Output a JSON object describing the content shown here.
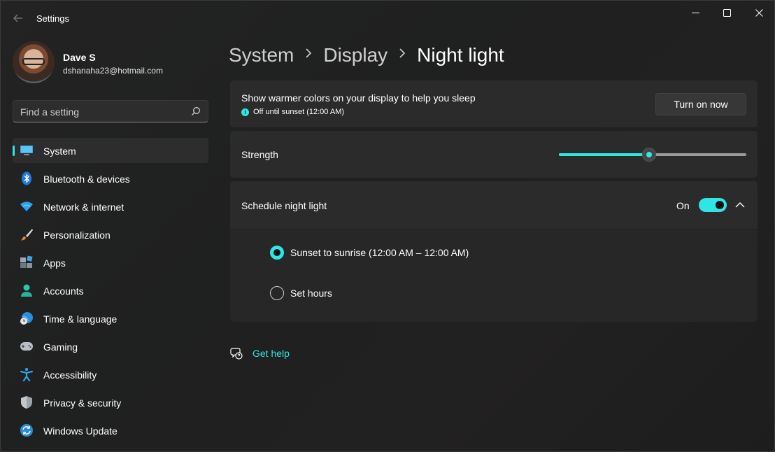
{
  "window": {
    "title": "Settings"
  },
  "profile": {
    "name": "Dave S",
    "email": "dshanaha23@hotmail.com"
  },
  "search": {
    "placeholder": "Find a setting"
  },
  "sidebar": {
    "items": [
      {
        "label": "System",
        "icon": "monitor-icon",
        "active": true
      },
      {
        "label": "Bluetooth & devices",
        "icon": "bluetooth-icon"
      },
      {
        "label": "Network & internet",
        "icon": "wifi-icon"
      },
      {
        "label": "Personalization",
        "icon": "brush-icon"
      },
      {
        "label": "Apps",
        "icon": "apps-icon"
      },
      {
        "label": "Accounts",
        "icon": "person-icon"
      },
      {
        "label": "Time & language",
        "icon": "globe-clock-icon"
      },
      {
        "label": "Gaming",
        "icon": "gamepad-icon"
      },
      {
        "label": "Accessibility",
        "icon": "accessibility-icon"
      },
      {
        "label": "Privacy & security",
        "icon": "shield-icon"
      },
      {
        "label": "Windows Update",
        "icon": "update-icon"
      }
    ]
  },
  "breadcrumb": {
    "items": [
      "System",
      "Display"
    ],
    "current": "Night light"
  },
  "night_light": {
    "description": "Show warmer colors on your display to help you sleep",
    "status": "Off until sunset (12:00 AM)",
    "button_label": "Turn on now"
  },
  "strength": {
    "label": "Strength",
    "value_percent": 48
  },
  "schedule": {
    "label": "Schedule night light",
    "toggle_state": "On",
    "options": [
      {
        "label": "Sunset to sunrise (12:00 AM – 12:00 AM)",
        "selected": true
      },
      {
        "label": "Set hours",
        "selected": false
      }
    ]
  },
  "help": {
    "link_label": "Get help"
  },
  "colors": {
    "accent": "#2ee6e6",
    "background": "#202020",
    "card": "#2b2b2b"
  }
}
